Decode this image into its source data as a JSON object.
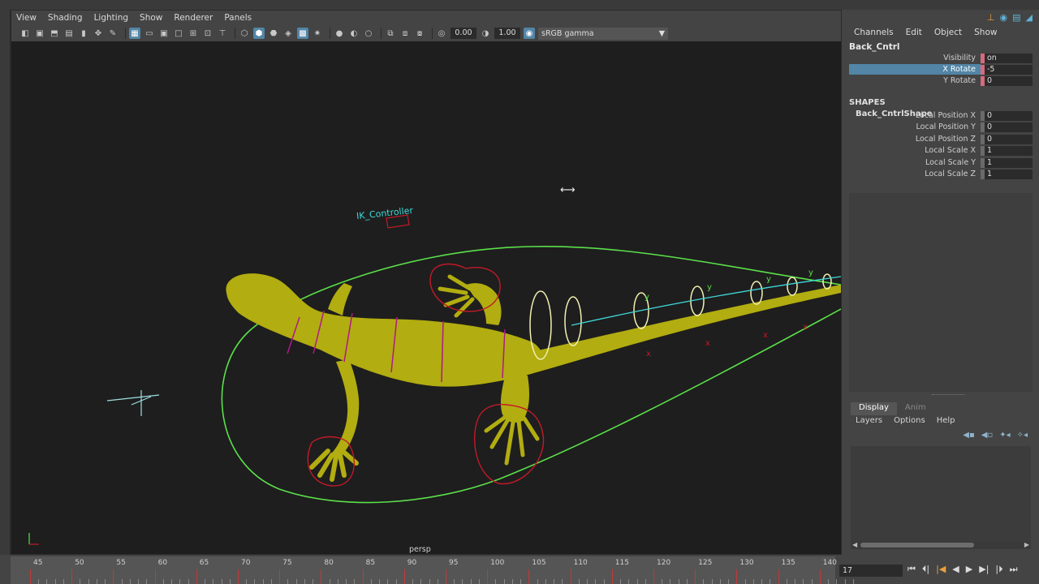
{
  "viewport": {
    "menu": [
      "View",
      "Shading",
      "Lighting",
      "Show",
      "Renderer",
      "Panels"
    ],
    "exposure_value": "0.00",
    "gamma_value": "1.00",
    "color_space": "sRGB gamma",
    "camera_label": "persp",
    "scene_labels": {
      "ik_controller": "IK_Controller",
      "axis_y": "y",
      "axis_x": "x"
    },
    "colors": {
      "background": "#1e1e1e",
      "mesh": "#b2ad10",
      "curve_green": "#5be04a",
      "curve_red": "#c21a28",
      "curve_magenta": "#b01888",
      "curve_yellow": "#f2f0b0",
      "curve_cyan": "#3fd9d9"
    }
  },
  "channel_box": {
    "menu": [
      "Channels",
      "Edit",
      "Object",
      "Show"
    ],
    "object_name": "Back_Cntrl",
    "channels": [
      {
        "label": "Visibility",
        "value": "on"
      },
      {
        "label": "X Rotate",
        "value": "-5",
        "selected": true
      },
      {
        "label": "Y Rotate",
        "value": "0"
      }
    ],
    "shapes_header": "SHAPES",
    "shape_name": "Back_CntrlShape",
    "shape_attrs": [
      {
        "label": "Local Position X",
        "value": "0"
      },
      {
        "label": "Local Position Y",
        "value": "0"
      },
      {
        "label": "Local Position Z",
        "value": "0"
      },
      {
        "label": "Local Scale X",
        "value": "1"
      },
      {
        "label": "Local Scale Y",
        "value": "1"
      },
      {
        "label": "Local Scale Z",
        "value": "1"
      }
    ]
  },
  "layer_editor": {
    "tabs": [
      "Display",
      "Anim"
    ],
    "menu": [
      "Layers",
      "Options",
      "Help"
    ]
  },
  "timeline": {
    "ticks": [
      "45",
      "50",
      "55",
      "60",
      "65",
      "70",
      "75",
      "80",
      "85",
      "90",
      "95",
      "100",
      "105",
      "110",
      "115",
      "120",
      "125",
      "130",
      "135",
      "140"
    ],
    "current_frame": "17"
  }
}
